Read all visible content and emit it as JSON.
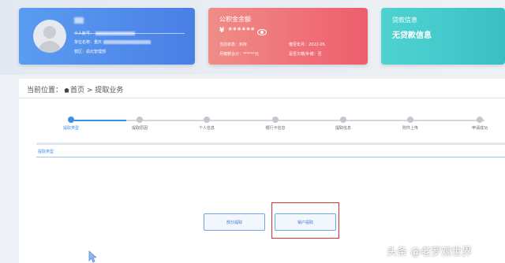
{
  "profile_card": {
    "account_label": "个人账号：",
    "employer_label": "单位名称：重庆",
    "region_label": "辖区：渝北管理部"
  },
  "balance_card": {
    "title": "公积金余额",
    "amount_masked": "¥ ******",
    "status": "当前状态：封存",
    "deposit_month": "缴至年月：2022-05",
    "monthly_total": "月缴额合计：******元",
    "delinquent": "是否欠缴/补缴：否"
  },
  "loan_card": {
    "title": "贷款信息",
    "value": "无贷款信息"
  },
  "breadcrumb": {
    "prefix": "当前位置：",
    "home": "首页",
    "separator": ">",
    "current": "提取业务"
  },
  "steps": [
    {
      "label": "提取类型",
      "active": true
    },
    {
      "label": "提取原因",
      "active": false
    },
    {
      "label": "个人信息",
      "active": false
    },
    {
      "label": "银行卡信息",
      "active": false
    },
    {
      "label": "提取信息",
      "active": false
    },
    {
      "label": "附件上传",
      "active": false
    },
    {
      "label": "申请成功",
      "active": false
    }
  ],
  "section": {
    "title": "提取类型"
  },
  "buttons": {
    "partial": "部分提取",
    "closeout": "销户提取"
  },
  "watermark": "头条 @老罗观世界",
  "colors": {
    "accent": "#3e8ee8",
    "highlight_box": "#d9322e"
  }
}
